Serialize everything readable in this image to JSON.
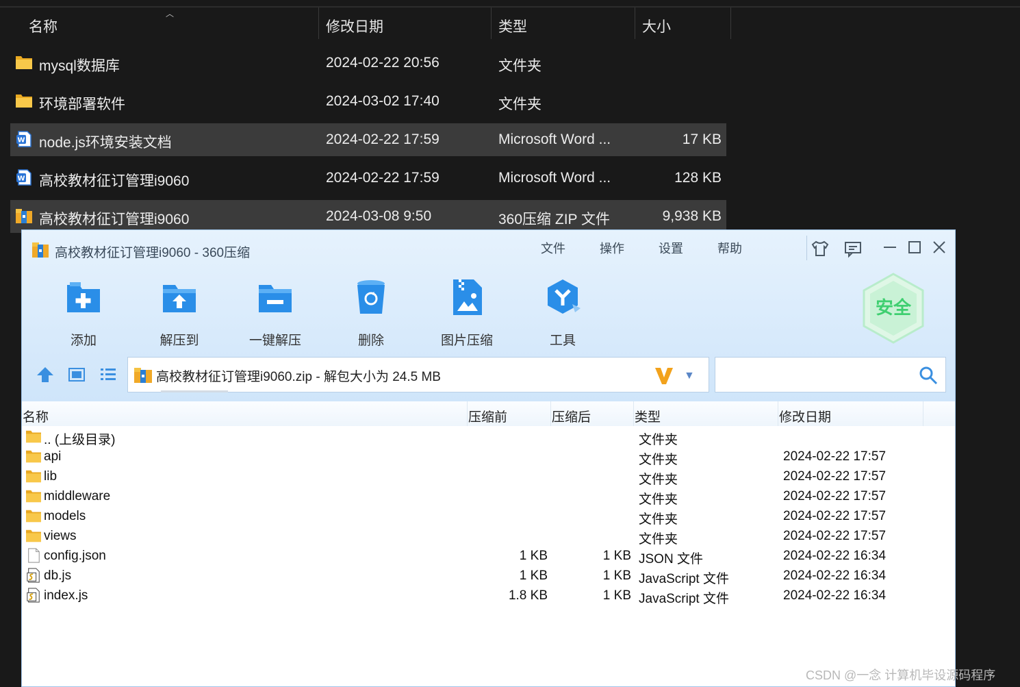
{
  "explorer": {
    "columns": {
      "name": "名称",
      "modified": "修改日期",
      "type": "类型",
      "size": "大小"
    },
    "rows": [
      {
        "name": "mysql数据库",
        "modified": "2024-02-22 20:56",
        "type": "文件夹",
        "size": "",
        "icon": "folder-icon",
        "selected": false
      },
      {
        "name": "环境部署软件",
        "modified": "2024-03-02 17:40",
        "type": "文件夹",
        "size": "",
        "icon": "folder-icon",
        "selected": false
      },
      {
        "name": "node.js环境安装文档",
        "modified": "2024-02-22 17:59",
        "type": "Microsoft Word ...",
        "size": "17 KB",
        "icon": "word-doc-icon",
        "selected": true
      },
      {
        "name": "高校教材征订管理i9060",
        "modified": "2024-02-22 17:59",
        "type": "Microsoft Word ...",
        "size": "128 KB",
        "icon": "word-doc-icon",
        "selected": false
      },
      {
        "name": "高校教材征订管理i9060",
        "modified": "2024-03-08 9:50",
        "type": "360压缩 ZIP 文件",
        "size": "9,938 KB",
        "icon": "zip-archive-icon",
        "selected": true
      }
    ]
  },
  "zip_window": {
    "title": "高校教材征订管理i9060 - 360压缩",
    "menu": [
      "文件",
      "操作",
      "设置",
      "帮助"
    ],
    "toolbar": [
      {
        "label": "添加",
        "icon": "add-folder-icon"
      },
      {
        "label": "解压到",
        "icon": "extract-to-icon"
      },
      {
        "label": "一键解压",
        "icon": "one-click-extract-icon"
      },
      {
        "label": "删除",
        "icon": "delete-bin-icon"
      },
      {
        "label": "图片压缩",
        "icon": "image-compress-icon"
      },
      {
        "label": "工具",
        "icon": "tools-icon"
      }
    ],
    "badge": "安全",
    "address": "高校教材征订管理i9060.zip - 解包大小为 24.5 MB",
    "search_value": "",
    "columns": {
      "name": "名称",
      "before": "压缩前",
      "after": "压缩后",
      "type": "类型",
      "modified": "修改日期"
    },
    "files": [
      {
        "name": ".. (上级目录)",
        "before": "",
        "after": "",
        "type": "文件夹",
        "modified": "",
        "icon": "folder-icon"
      },
      {
        "name": "api",
        "before": "",
        "after": "",
        "type": "文件夹",
        "modified": "2024-02-22 17:57",
        "icon": "folder-icon"
      },
      {
        "name": "lib",
        "before": "",
        "after": "",
        "type": "文件夹",
        "modified": "2024-02-22 17:57",
        "icon": "folder-icon"
      },
      {
        "name": "middleware",
        "before": "",
        "after": "",
        "type": "文件夹",
        "modified": "2024-02-22 17:57",
        "icon": "folder-icon"
      },
      {
        "name": "models",
        "before": "",
        "after": "",
        "type": "文件夹",
        "modified": "2024-02-22 17:57",
        "icon": "folder-icon"
      },
      {
        "name": "views",
        "before": "",
        "after": "",
        "type": "文件夹",
        "modified": "2024-02-22 17:57",
        "icon": "folder-icon"
      },
      {
        "name": "config.json",
        "before": "1 KB",
        "after": "1 KB",
        "type": "JSON 文件",
        "modified": "2024-02-22 16:34",
        "icon": "file-icon"
      },
      {
        "name": "db.js",
        "before": "1 KB",
        "after": "1 KB",
        "type": "JavaScript 文件",
        "modified": "2024-02-22 16:34",
        "icon": "script-file-icon"
      },
      {
        "name": "index.js",
        "before": "1.8 KB",
        "after": "1 KB",
        "type": "JavaScript 文件",
        "modified": "2024-02-22 16:34",
        "icon": "script-file-icon"
      }
    ]
  },
  "watermark": "CSDN @一念 计算机毕设源码程序",
  "colors": {
    "folder": "#f5c242",
    "accent_blue": "#2a8ee8",
    "safe_green": "#3fcf70"
  }
}
